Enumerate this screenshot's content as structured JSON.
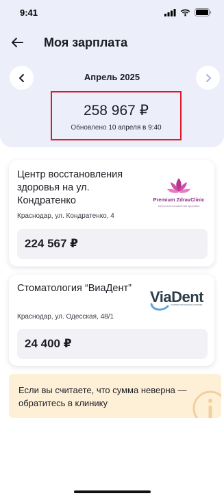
{
  "status_bar": {
    "time": "9:41"
  },
  "nav": {
    "title": "Моя зарплата"
  },
  "period": {
    "label": "Апрель 2025"
  },
  "total": {
    "amount": "258 967 ₽",
    "updated_prefix": "Обновлено",
    "updated_value": "10 апреля в 9:40"
  },
  "clinics": [
    {
      "name": "Центр восстановления здоровья на ул. Кондратенко",
      "address": "Краснодар, ул. Кондратенко, 4",
      "amount": "224 567 ₽",
      "logo_text": "Premium ZdravClinic",
      "logo_sub": "Центр восстановления здоровья"
    },
    {
      "name": "Стоматология “ВиаДент”",
      "address": "Краснодар, ул. Одесская, 48/1",
      "amount": "24 400 ₽",
      "logo_text": "ViaDent",
      "logo_sub": "стоматологическая клиника"
    }
  ],
  "notice": {
    "text": "Если вы считаете, что сумма неверна — обратитесь в клинику"
  },
  "colors": {
    "header_bg": "#eceef9",
    "highlight_border": "#e0182a",
    "notice_bg": "#fdf0d7",
    "brand_purple": "#8d2b83"
  }
}
